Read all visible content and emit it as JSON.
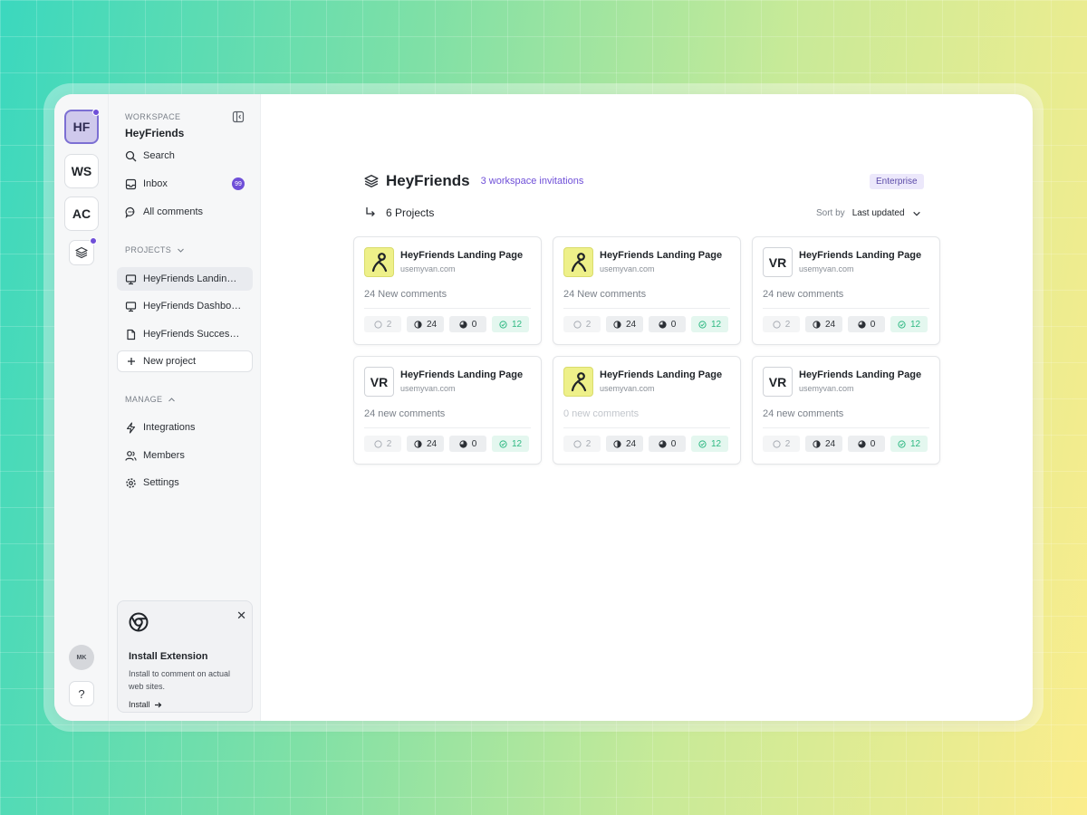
{
  "rail": {
    "workspaces": [
      {
        "abbr": "HF",
        "active": true,
        "notify": true
      },
      {
        "abbr": "WS",
        "active": false,
        "notify": false
      },
      {
        "abbr": "AC",
        "active": false,
        "notify": false
      }
    ],
    "layers_icon": "layers-icon",
    "avatar_initials": "MK",
    "help_label": "?"
  },
  "sidebar": {
    "workspace_label": "WORKSPACE",
    "workspace_name": "HeyFriends",
    "nav": [
      {
        "label": "Search",
        "icon": "search-icon"
      },
      {
        "label": "Inbox",
        "icon": "inbox-icon",
        "badge": "99"
      },
      {
        "label": "All comments",
        "icon": "comments-icon"
      }
    ],
    "projects_label": "PROJECTS",
    "projects": [
      {
        "label": "HeyFriends Landing Page",
        "icon": "monitor-icon",
        "selected": true
      },
      {
        "label": "HeyFriends Dashboard",
        "icon": "monitor-icon",
        "selected": false
      },
      {
        "label": "HeyFriends Success Stories",
        "icon": "document-icon",
        "selected": false
      }
    ],
    "new_project_label": "New project",
    "manage_label": "MANAGE",
    "manage": [
      {
        "label": "Integrations",
        "icon": "bolt-icon"
      },
      {
        "label": "Members",
        "icon": "users-icon"
      },
      {
        "label": "Settings",
        "icon": "gear-icon"
      }
    ],
    "extension": {
      "title": "Install Extension",
      "description": "Install to comment on actual web sites.",
      "install_label": "Install"
    }
  },
  "main": {
    "title": "HeyFriends",
    "invitations": "3 workspace invitations",
    "plan_badge": "Enterprise",
    "project_count": "6 Projects",
    "sort_label": "Sort by",
    "sort_value": "Last updated",
    "colors": {
      "accent": "#6f4fd8",
      "success": "#2fb983",
      "logo_yellow": "#eef089"
    },
    "cards": [
      {
        "logo": "yellow",
        "logo_text": "",
        "title": "HeyFriends Landing Page",
        "url": "usemyvan.com",
        "comments": "24 New comments",
        "dim": false,
        "stats": [
          "2",
          "24",
          "0",
          "12"
        ]
      },
      {
        "logo": "yellow",
        "logo_text": "",
        "title": "HeyFriends Landing Page",
        "url": "usemyvan.com",
        "comments": "24 New comments",
        "dim": false,
        "stats": [
          "2",
          "24",
          "0",
          "12"
        ]
      },
      {
        "logo": "vr",
        "logo_text": "VR",
        "title": "HeyFriends Landing Page",
        "url": "usemyvan.com",
        "comments": "24 new comments",
        "dim": false,
        "stats": [
          "2",
          "24",
          "0",
          "12"
        ]
      },
      {
        "logo": "vr",
        "logo_text": "VR",
        "title": "HeyFriends Landing Page",
        "url": "usemyvan.com",
        "comments": "24 new comments",
        "dim": false,
        "stats": [
          "2",
          "24",
          "0",
          "12"
        ]
      },
      {
        "logo": "yellow",
        "logo_text": "",
        "title": "HeyFriends Landing Page",
        "url": "usemyvan.com",
        "comments": "0 new comments",
        "dim": true,
        "stats": [
          "2",
          "24",
          "0",
          "12"
        ]
      },
      {
        "logo": "vr",
        "logo_text": "VR",
        "title": "HeyFriends Landing Page",
        "url": "usemyvan.com",
        "comments": "24 new comments",
        "dim": false,
        "stats": [
          "2",
          "24",
          "0",
          "12"
        ]
      }
    ]
  }
}
